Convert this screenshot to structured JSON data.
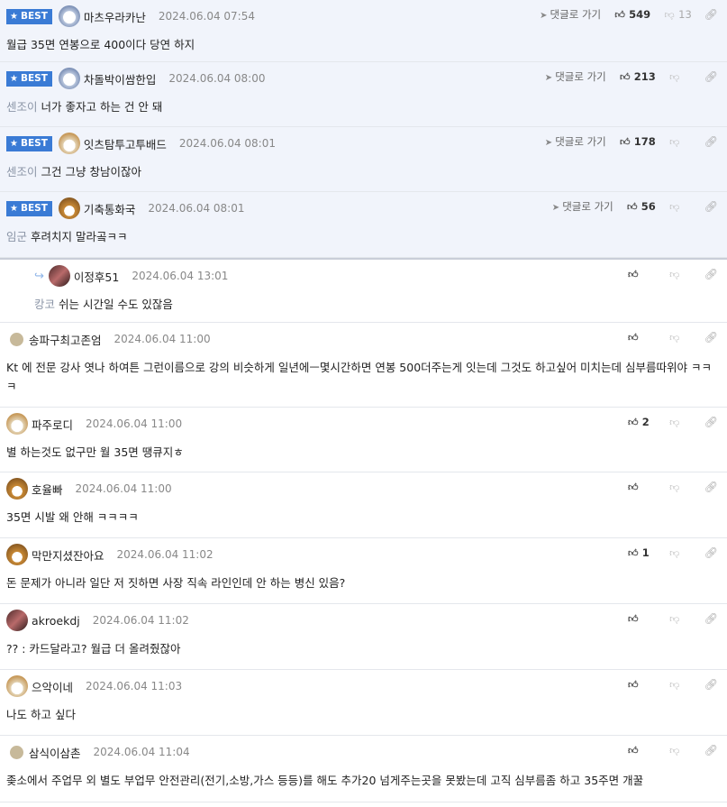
{
  "ui": {
    "goto_label": "댓글로 가기",
    "best_label": "BEST"
  },
  "comments": [
    {
      "nick": "마츠우라카난",
      "time": "2024.06.04 07:54",
      "mention": "",
      "text": "월급 35면 연봉으로 400이다 당연 하지",
      "likes": "549",
      "dislikes": "13",
      "best": true
    },
    {
      "nick": "차돌박이쌈한입",
      "time": "2024.06.04 08:00",
      "mention": "센조이",
      "text": "너가 좋자고 하는 건 안 돼",
      "likes": "213",
      "dislikes": "",
      "best": true
    },
    {
      "nick": "잇츠탐투고투배드",
      "time": "2024.06.04 08:01",
      "mention": "센조이",
      "text": "그건 그냥 창남이잖아",
      "likes": "178",
      "dislikes": "",
      "best": true
    },
    {
      "nick": "기축통화국",
      "time": "2024.06.04 08:01",
      "mention": "임군",
      "text": "후려치지 말라곸ㅋㅋ",
      "likes": "56",
      "dislikes": "",
      "best": true
    },
    {
      "nick": "이정후51",
      "time": "2024.06.04 13:01",
      "mention": "캉코",
      "text": "쉬는 시간일 수도 있잖음",
      "likes": "",
      "dislikes": "",
      "best": false,
      "reply": true
    },
    {
      "nick": "송파구최고존엄",
      "time": "2024.06.04 11:00",
      "mention": "",
      "text": "Kt 에 전문 강사 엿나 하여튼 그런이름으로 강의 비슷하게 일년에ㅡ몇시간하면 연봉 500더주는게 잇는데 그것도 하고싶어 미치는데 심부름따위야 ㅋㅋㅋ",
      "likes": "",
      "dislikes": "",
      "best": false
    },
    {
      "nick": "파주로디",
      "time": "2024.06.04 11:00",
      "mention": "",
      "text": "별 하는것도 없구만 월 35면 땡큐지ㅎ",
      "likes": "2",
      "dislikes": "",
      "best": false
    },
    {
      "nick": "호율빠",
      "time": "2024.06.04 11:00",
      "mention": "",
      "text": "35면 시발 왜 안해 ㅋㅋㅋㅋ",
      "likes": "",
      "dislikes": "",
      "best": false
    },
    {
      "nick": "막만지셨잔아요",
      "time": "2024.06.04 11:02",
      "mention": "",
      "text": "돈 문제가 아니라 일단 저 짓하면 사장 직속 라인인데 안 하는 병신 있음?",
      "likes": "1",
      "dislikes": "",
      "best": false
    },
    {
      "nick": "akroekdj",
      "time": "2024.06.04 11:02",
      "mention": "",
      "text": "?? : 카드달라고? 월급 더 올려줬잖아",
      "likes": "",
      "dislikes": "",
      "best": false
    },
    {
      "nick": "으악이네",
      "time": "2024.06.04 11:03",
      "mention": "",
      "text": "나도 하고 싶다",
      "likes": "",
      "dislikes": "",
      "best": false
    },
    {
      "nick": "삼식이삼촌",
      "time": "2024.06.04 11:04",
      "mention": "",
      "text": "좆소에서 주업무 외 별도 부업무 안전관리(전기,소방,가스 등등)를 해도 추가20 넘게주는곳을 못봤는데 고직 심부름좀 하고 35주면 개꿀",
      "likes": "",
      "dislikes": "",
      "best": false
    }
  ]
}
